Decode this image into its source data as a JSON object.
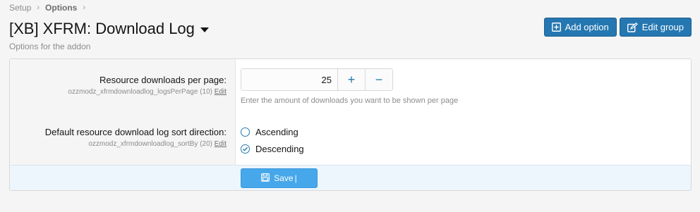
{
  "breadcrumb": {
    "items": [
      "Setup",
      "Options"
    ],
    "separator": "›"
  },
  "header": {
    "title": "[XB] XFRM: Download Log",
    "description": "Options for the addon",
    "buttons": {
      "add_option": "Add option",
      "edit_group": "Edit group"
    }
  },
  "options": [
    {
      "label": "Resource downloads per page:",
      "meta": "ozzmodz_xfrmdownloadlog_logsPerPage (10)",
      "edit": "Edit",
      "value": "25",
      "plus": "+",
      "minus": "−",
      "hint": "Enter the amount of downloads you want to be shown per page"
    },
    {
      "label": "Default resource download log sort direction:",
      "meta": "ozzmodz_xfrmdownloadlog_sortBy (20)",
      "edit": "Edit",
      "choices": [
        {
          "label": "Ascending",
          "selected": false
        },
        {
          "label": "Descending",
          "selected": true
        }
      ]
    }
  ],
  "footer": {
    "save_label": "Save"
  },
  "colors": {
    "accent": "#2577b1",
    "save": "#47a7eb",
    "footer_bg": "#edf6fd"
  }
}
